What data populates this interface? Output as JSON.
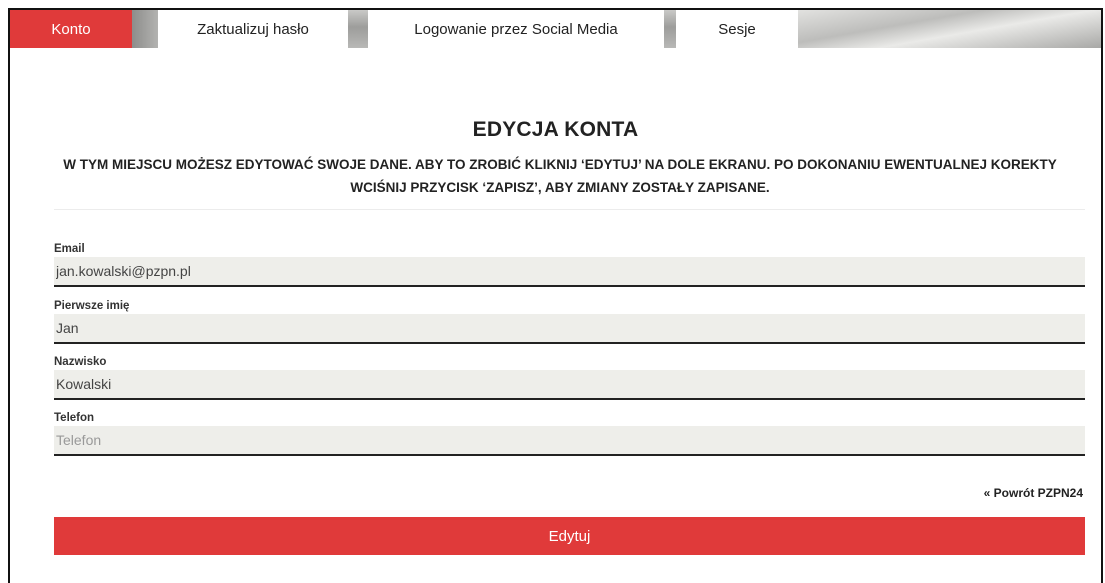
{
  "tabs": [
    {
      "label": "Konto",
      "active": true
    },
    {
      "label": "Zaktualizuj hasło",
      "active": false
    },
    {
      "label": "Logowanie przez Social Media",
      "active": false
    },
    {
      "label": "Sesje",
      "active": false
    }
  ],
  "page": {
    "title": "EDYCJA KONTA",
    "description": "W TYM MIEJSCU MOŻESZ EDYTOWAĆ SWOJE DANE. ABY TO ZROBIĆ KLIKNIJ ‘EDYTUJ’ NA DOLE EKRANU. PO DOKONANIU EWENTUALNEJ KOREKTY WCIŚNIJ PRZYCISK ‘ZAPISZ’, ABY ZMIANY ZOSTAŁY ZAPISANE."
  },
  "form": {
    "email": {
      "label": "Email",
      "value": "jan.kowalski@pzpn.pl"
    },
    "first_name": {
      "label": "Pierwsze imię",
      "value": "Jan"
    },
    "last_name": {
      "label": "Nazwisko",
      "value": "Kowalski"
    },
    "phone": {
      "label": "Telefon",
      "value": "",
      "placeholder": "Telefon"
    }
  },
  "back_link": "« Powrót PZPN24",
  "edit_button": "Edytuj",
  "colors": {
    "accent": "#e03a3a",
    "field_bg": "#eeeeea"
  }
}
